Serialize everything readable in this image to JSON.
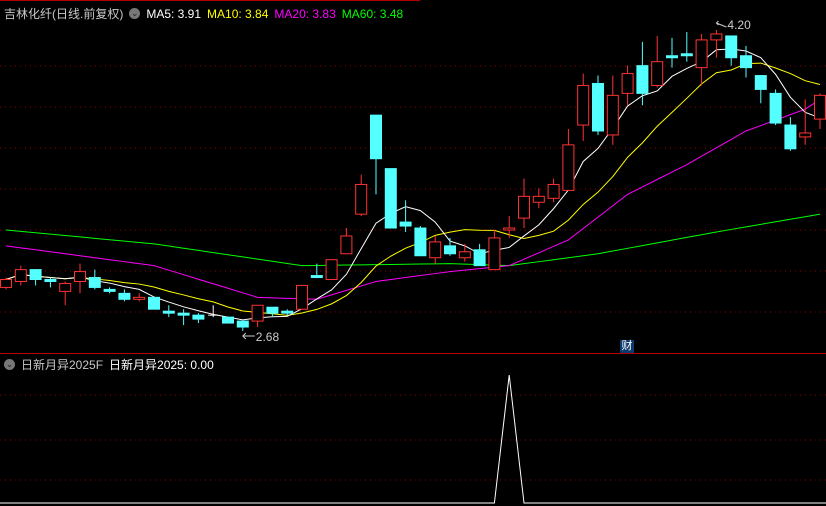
{
  "main_panel": {
    "title": "吉林化纤(日线.前复权)",
    "ma_labels": [
      {
        "text": "MA5: 3.91",
        "color": "#ffffff"
      },
      {
        "text": "MA10: 3.84",
        "color": "#ffff00"
      },
      {
        "text": "MA20: 3.83",
        "color": "#ff00ff"
      },
      {
        "text": "MA60: 3.48",
        "color": "#00ff00"
      }
    ],
    "low_marker": "2.68",
    "high_marker": "4.20",
    "finance_badge": "财"
  },
  "sub_panel": {
    "title": "日新月异2025F",
    "value_label": "日新月异2025: 0.00"
  },
  "colors": {
    "up": "#ff3232",
    "down": "#54ffff",
    "ma5": "#ffffff",
    "ma10": "#ffff00",
    "ma20": "#ff00ff",
    "ma60": "#00ff00",
    "grid": "#8b0000",
    "divider": "#b00000"
  },
  "chart_data": {
    "type": "candlestick",
    "price_range": [
      2.68,
      4.2
    ],
    "candles": [
      [
        2.9,
        2.95,
        2.89,
        2.94
      ],
      [
        2.93,
        3.01,
        2.91,
        2.99
      ],
      [
        2.99,
        2.99,
        2.91,
        2.94
      ],
      [
        2.94,
        2.95,
        2.9,
        2.93
      ],
      [
        2.88,
        2.93,
        2.81,
        2.92
      ],
      [
        2.93,
        3.02,
        2.87,
        2.98
      ],
      [
        2.95,
        2.99,
        2.89,
        2.9
      ],
      [
        2.89,
        2.9,
        2.87,
        2.88
      ],
      [
        2.87,
        2.89,
        2.83,
        2.84
      ],
      [
        2.84,
        2.87,
        2.83,
        2.85
      ],
      [
        2.85,
        2.85,
        2.79,
        2.79
      ],
      [
        2.78,
        2.81,
        2.75,
        2.77
      ],
      [
        2.77,
        2.79,
        2.71,
        2.76
      ],
      [
        2.76,
        2.77,
        2.72,
        2.74
      ],
      [
        2.76,
        2.81,
        2.75,
        2.76
      ],
      [
        2.75,
        2.75,
        2.72,
        2.72
      ],
      [
        2.73,
        2.73,
        2.68,
        2.7
      ],
      [
        2.73,
        2.81,
        2.7,
        2.81
      ],
      [
        2.8,
        2.8,
        2.75,
        2.77
      ],
      [
        2.78,
        2.79,
        2.76,
        2.77
      ],
      [
        2.79,
        2.91,
        2.79,
        2.91
      ],
      [
        2.96,
        3.02,
        2.95,
        2.95
      ],
      [
        2.94,
        3.04,
        2.94,
        3.04
      ],
      [
        3.07,
        3.2,
        3.07,
        3.16
      ],
      [
        3.27,
        3.47,
        3.26,
        3.42
      ],
      [
        3.77,
        3.77,
        3.37,
        3.55
      ],
      [
        3.5,
        3.5,
        3.2,
        3.2
      ],
      [
        3.23,
        3.34,
        3.18,
        3.21
      ],
      [
        3.2,
        3.21,
        3.06,
        3.06
      ],
      [
        3.05,
        3.16,
        3.02,
        3.13
      ],
      [
        3.11,
        3.15,
        3.06,
        3.07
      ],
      [
        3.05,
        3.12,
        3.03,
        3.08
      ],
      [
        3.09,
        3.12,
        3.01,
        3.01
      ],
      [
        2.99,
        3.19,
        2.99,
        3.15
      ],
      [
        3.19,
        3.26,
        3.15,
        3.2
      ],
      [
        3.25,
        3.45,
        3.2,
        3.36
      ],
      [
        3.33,
        3.4,
        3.3,
        3.36
      ],
      [
        3.35,
        3.45,
        3.33,
        3.42
      ],
      [
        3.39,
        3.7,
        3.39,
        3.62
      ],
      [
        3.72,
        3.98,
        3.64,
        3.92
      ],
      [
        3.93,
        3.97,
        3.67,
        3.69
      ],
      [
        3.67,
        3.97,
        3.62,
        3.87
      ],
      [
        3.88,
        4.02,
        3.82,
        3.98
      ],
      [
        4.02,
        4.14,
        3.82,
        3.88
      ],
      [
        3.92,
        4.17,
        3.91,
        4.04
      ],
      [
        4.07,
        4.16,
        4.01,
        4.06
      ],
      [
        4.08,
        4.19,
        4.04,
        4.07
      ],
      [
        4.01,
        4.18,
        3.92,
        4.15
      ],
      [
        4.15,
        4.2,
        4.06,
        4.18
      ],
      [
        4.17,
        4.17,
        4.02,
        4.06
      ],
      [
        4.07,
        4.12,
        3.96,
        4.01
      ],
      [
        3.97,
        3.97,
        3.83,
        3.9
      ],
      [
        3.88,
        3.9,
        3.72,
        3.73
      ],
      [
        3.72,
        3.76,
        3.59,
        3.6
      ],
      [
        3.66,
        3.85,
        3.62,
        3.68
      ],
      [
        3.75,
        3.88,
        3.7,
        3.87
      ]
    ],
    "doji_indices": [
      14
    ],
    "ma20_points": [
      [
        0,
        3.11
      ],
      [
        10,
        3.01
      ],
      [
        17,
        2.85
      ],
      [
        21,
        2.84
      ],
      [
        25,
        2.93
      ],
      [
        30,
        2.98
      ],
      [
        34,
        3.01
      ],
      [
        38,
        3.14
      ],
      [
        42,
        3.37
      ],
      [
        46,
        3.52
      ],
      [
        50,
        3.69
      ],
      [
        54,
        3.8
      ],
      [
        55,
        3.85
      ]
    ],
    "ma60_points": [
      [
        0,
        3.19
      ],
      [
        10,
        3.12
      ],
      [
        20,
        3.01
      ],
      [
        30,
        3.02
      ],
      [
        34,
        3.01
      ],
      [
        40,
        3.07
      ],
      [
        48,
        3.18
      ],
      [
        55,
        3.27
      ]
    ],
    "low_index": 16,
    "high_index": 48,
    "indicator_signal": {
      "index": 34,
      "values_zero_elsewhere": 0,
      "peak": 1
    }
  }
}
